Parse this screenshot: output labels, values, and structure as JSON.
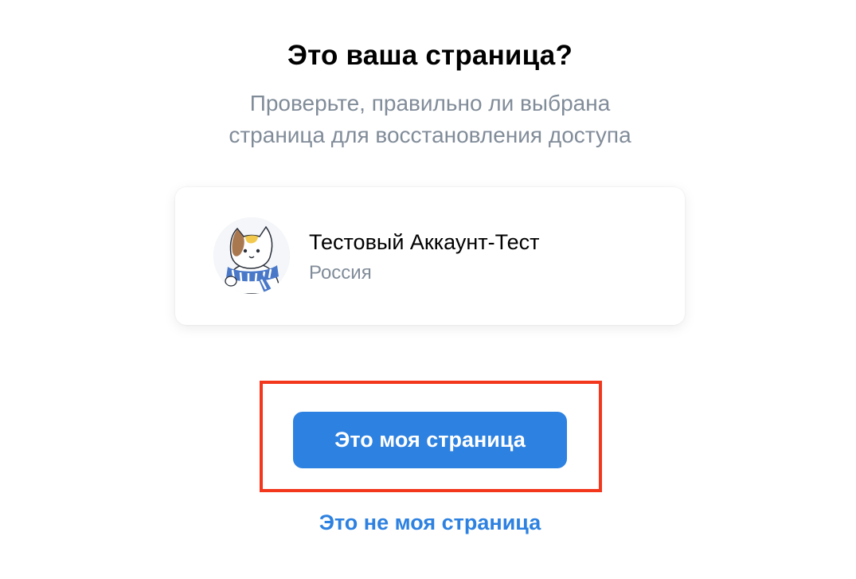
{
  "header": {
    "title": "Это ваша страница?",
    "subtitle_line1": "Проверьте, правильно ли выбрана",
    "subtitle_line2": "страница для восстановления доступа"
  },
  "profile": {
    "name": "Тестовый Аккаунт-Тест",
    "country": "Россия",
    "avatar_icon": "cat-in-scarf-avatar"
  },
  "actions": {
    "confirm_label": "Это моя страница",
    "deny_label": "Это не моя страница"
  },
  "colors": {
    "accent": "#2d81e0",
    "secondary_text": "#818c99",
    "highlight_border": "#f2371d"
  }
}
